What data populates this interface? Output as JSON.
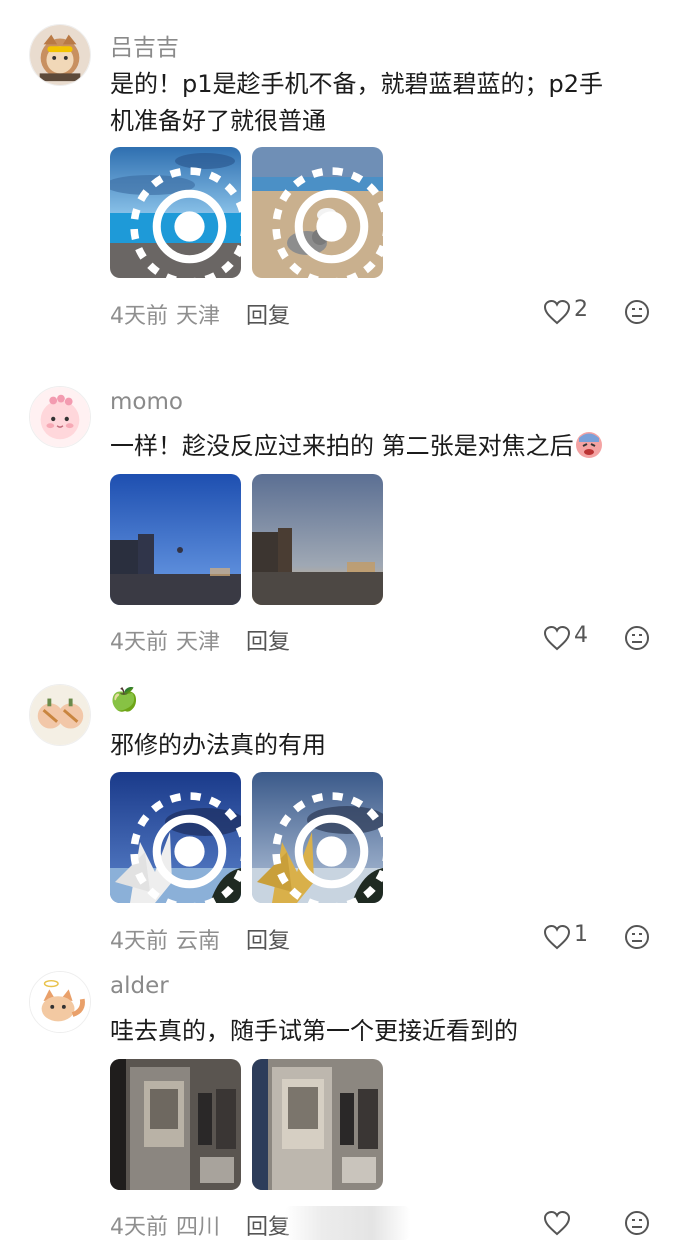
{
  "comments": [
    {
      "username": "吕吉吉",
      "text_line1": "是的！p1是趁手机不备，就碧蓝碧蓝的；p2手",
      "text_line2": "机准备好了就很普通",
      "time": "4天前",
      "region": "天津",
      "reply": "回复",
      "likes": "2",
      "images": [
        "beach-blue",
        "beach-dogs"
      ]
    },
    {
      "username": "momo",
      "text": "一样！趁没反应过来拍的 第二张是对焦之后",
      "time": "4天前",
      "region": "天津",
      "reply": "回复",
      "likes": "4",
      "images": [
        "dusk-plaza-blue",
        "dusk-plaza-warm"
      ]
    },
    {
      "username": "🍏",
      "text": "邪修的办法真的有用",
      "time": "4天前",
      "region": "云南",
      "reply": "回复",
      "likes": "1",
      "images": [
        "lily-blue",
        "lily-warm"
      ]
    },
    {
      "username": "alder",
      "text": "哇去真的，随手试第一个更接近看到的",
      "time": "4天前",
      "region": "四川",
      "reply": "回复",
      "likes": "",
      "images": [
        "room-door",
        "room-door-2"
      ]
    }
  ],
  "colors": {
    "username": "#8a8a8a",
    "meta": "#8f8f8f",
    "text": "#1b1b1b"
  },
  "icons": [
    "heart-icon",
    "face-icon",
    "live-photo-icon"
  ]
}
